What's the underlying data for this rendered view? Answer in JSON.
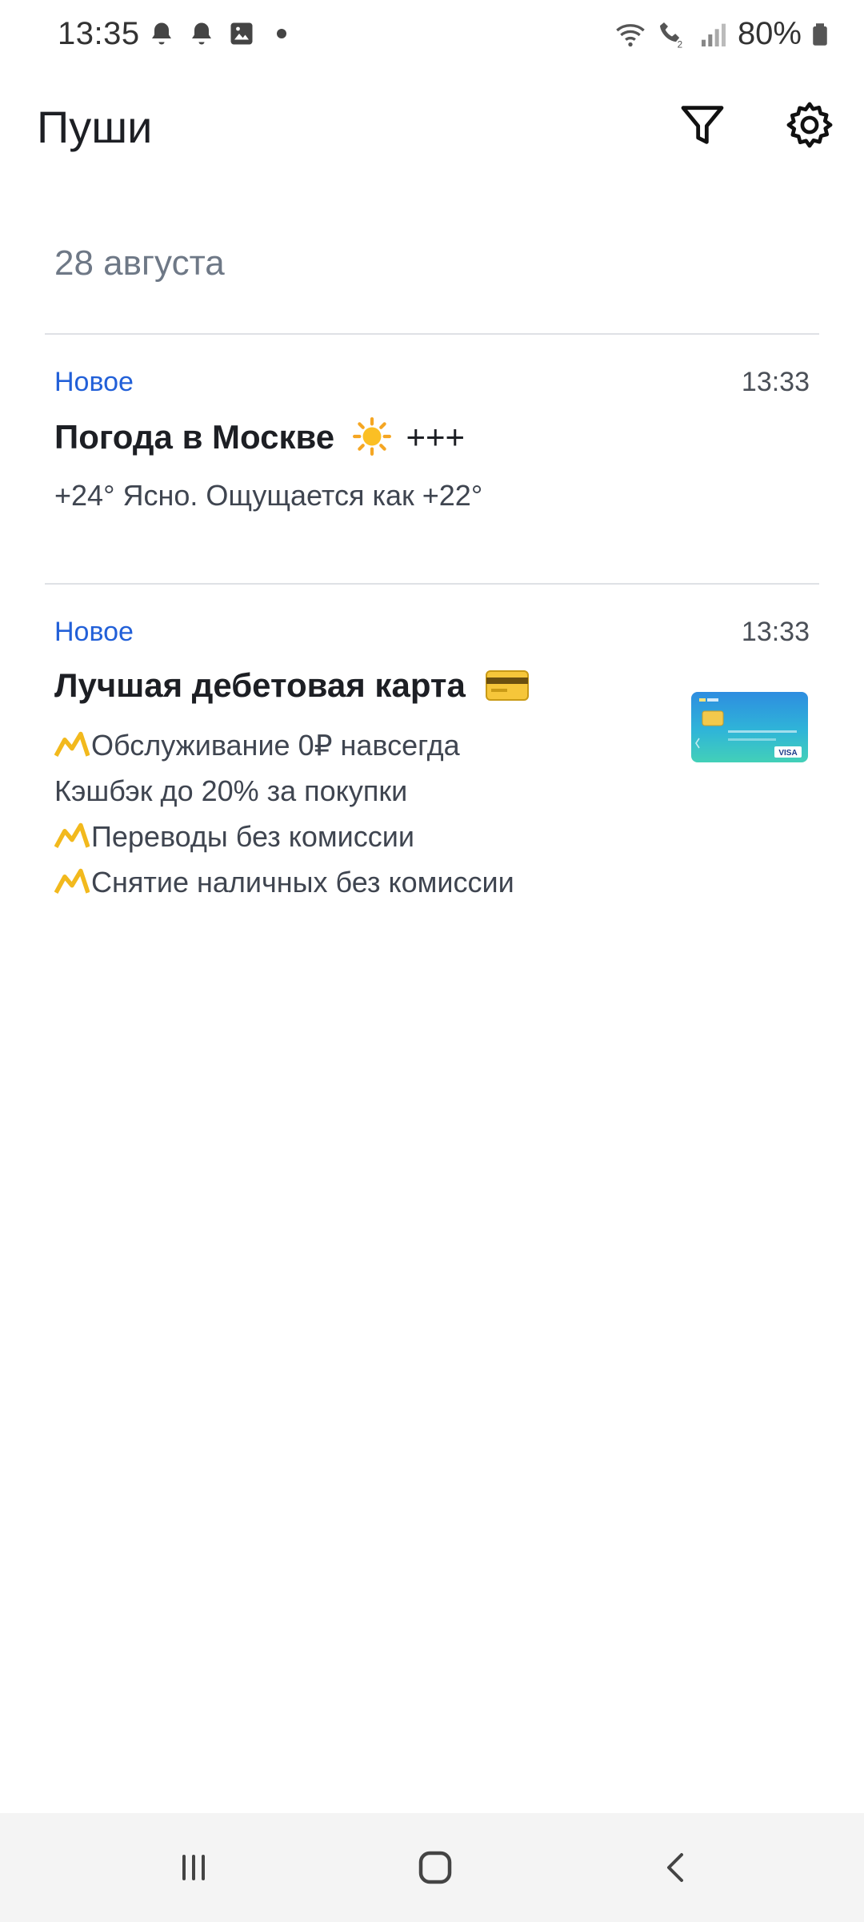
{
  "status_bar": {
    "time": "13:35",
    "left_icons": [
      "alarm-icon",
      "alarm-icon",
      "image-notification-icon",
      "dot-icon"
    ],
    "right_icons": [
      "wifi-icon",
      "volte-call-icon",
      "signal-icon",
      "battery-icon"
    ],
    "battery_text": "80%"
  },
  "app_bar": {
    "title": "Пуши",
    "filter_icon": "filter-icon",
    "settings_icon": "gear-icon"
  },
  "feed": {
    "date_header": "28 августа",
    "notifications": [
      {
        "badge": "Новое",
        "time": "13:33",
        "title": "Погода в Москве",
        "title_suffix": "+++",
        "title_emoji": "sun-icon",
        "body": [
          "+24° Ясно. Ощущается как +22°"
        ]
      },
      {
        "badge": "Новое",
        "time": "13:33",
        "title": "Лучшая дебетовая карта",
        "title_emoji": "credit-card-icon",
        "body": [
          "Обслуживание 0₽ навсегда",
          "Кэшбэк до 20% за покупки",
          "Переводы без комиссии",
          "Снятие наличных без комиссии"
        ],
        "thumbnail_brand": "VISA"
      }
    ]
  },
  "nav_bar": {
    "buttons": [
      "recents-icon",
      "home-icon",
      "back-icon"
    ]
  },
  "colors": {
    "accent": "#2260d8",
    "date_text": "#6e7886",
    "divider": "#dfe1e5",
    "nav_background": "#f4f4f4",
    "chart_glyph": "#f2b91d"
  }
}
